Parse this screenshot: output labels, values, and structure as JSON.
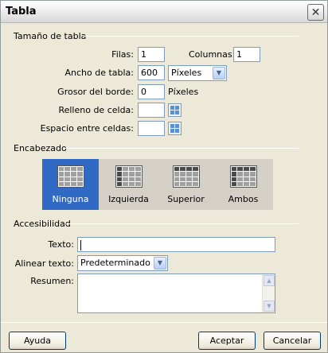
{
  "window": {
    "title": "Tabla"
  },
  "table_size": {
    "legend": "Tamaño de tabla",
    "rows_label": "Filas:",
    "rows_value": "1",
    "columns_label": "Columnas:",
    "columns_value": "1",
    "width_label": "Ancho de tabla:",
    "width_value": "600",
    "width_unit": "Píxeles",
    "border_label": "Grosor del borde:",
    "border_value": "0",
    "border_unit": "Píxeles",
    "padding_label": "Relleno de celda:",
    "padding_value": "",
    "spacing_label": "Espacio entre celdas:",
    "spacing_value": ""
  },
  "header": {
    "legend": "Encabezado",
    "options": [
      {
        "label": "Ninguna",
        "selected": true
      },
      {
        "label": "Izquierda",
        "selected": false
      },
      {
        "label": "Superior",
        "selected": false
      },
      {
        "label": "Ambos",
        "selected": false
      }
    ]
  },
  "accessibility": {
    "legend": "Accesibilidad",
    "text_label": "Texto:",
    "text_value": "",
    "align_label": "Alinear texto:",
    "align_value": "Predeterminado",
    "summary_label": "Resumen:",
    "summary_value": ""
  },
  "buttons": {
    "help": "Ayuda",
    "ok": "Aceptar",
    "cancel": "Cancelar"
  }
}
